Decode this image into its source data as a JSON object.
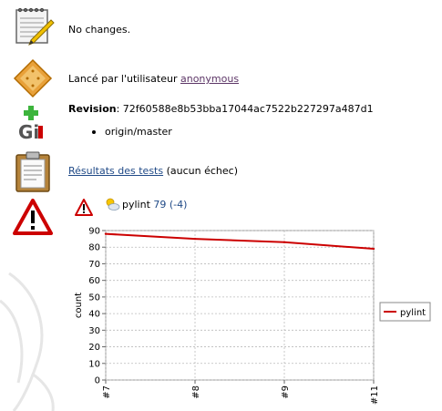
{
  "summary": {
    "changes_text": "No changes.",
    "started_by_prefix": "Lancé par l'utilisateur ",
    "started_by_user": "anonymous",
    "revision_label": "Revision",
    "revision_sep": ": ",
    "revision_hash": "72f60588e8b53bba17044ac7522b227297a487d1",
    "branch": "origin/master",
    "tests_link": "Résultats des tests",
    "tests_suffix": " (aucun échec)"
  },
  "pylint": {
    "label": "pylint",
    "score": "79",
    "delta": "(-4)"
  },
  "icons": {
    "changes": "notepad-pencil-icon",
    "user": "user-build-icon",
    "git": "git-icon",
    "tests": "clipboard-icon",
    "warning": "warning-icon",
    "small_warning": "warning-icon",
    "weather": "partly-cloudy-icon"
  },
  "colors": {
    "series": "#cc0000",
    "link": "#204a87",
    "user_link": "#5c3566",
    "warning_red": "#cc0000"
  },
  "chart_data": {
    "type": "line",
    "categories": [
      "#7",
      "#8",
      "#9",
      "#11"
    ],
    "series": [
      {
        "name": "pylint",
        "values": [
          88,
          85,
          83,
          79
        ]
      }
    ],
    "ylabel": "count",
    "xlabel": "",
    "ylim": [
      0,
      90
    ],
    "yticks": [
      0,
      10,
      20,
      30,
      40,
      50,
      60,
      70,
      80,
      90
    ],
    "grid": true,
    "legend": "right"
  }
}
